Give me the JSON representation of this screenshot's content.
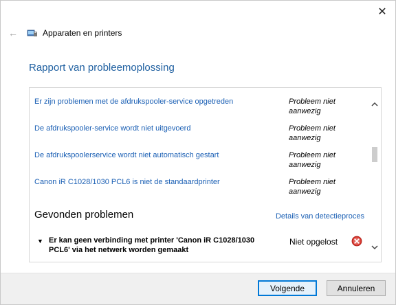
{
  "window": {
    "close_glyph": "✕"
  },
  "nav": {
    "title": "Apparaten en printers",
    "back_glyph": "←"
  },
  "heading": "Rapport van probleemoplossing",
  "issues": [
    {
      "label": "Er zijn problemen met de afdrukspooler-service opgetreden",
      "status": "Probleem niet aanwezig"
    },
    {
      "label": "De afdrukspooler-service wordt niet uitgevoerd",
      "status": "Probleem niet aanwezig"
    },
    {
      "label": "De afdrukspoolerservice wordt niet automatisch gestart",
      "status": "Probleem niet aanwezig"
    },
    {
      "label": "Canon iR C1028/1030 PCL6 is niet de standaardprinter",
      "status": "Probleem niet aanwezig"
    }
  ],
  "found_section": {
    "title": "Gevonden problemen",
    "details_link": "Details van detectieproces",
    "problem": {
      "text": "Er kan geen verbinding met printer 'Canon iR C1028/1030 PCL6' via het netwerk worden gemaakt",
      "status": "Niet opgelost",
      "icon": "error-icon"
    }
  },
  "footer": {
    "next_label": "Volgende",
    "cancel_label": "Annuleren"
  },
  "colors": {
    "link": "#1a5fb4",
    "heading": "#1e5fa0",
    "error": "#d9342b",
    "primary_border": "#0078d7"
  }
}
